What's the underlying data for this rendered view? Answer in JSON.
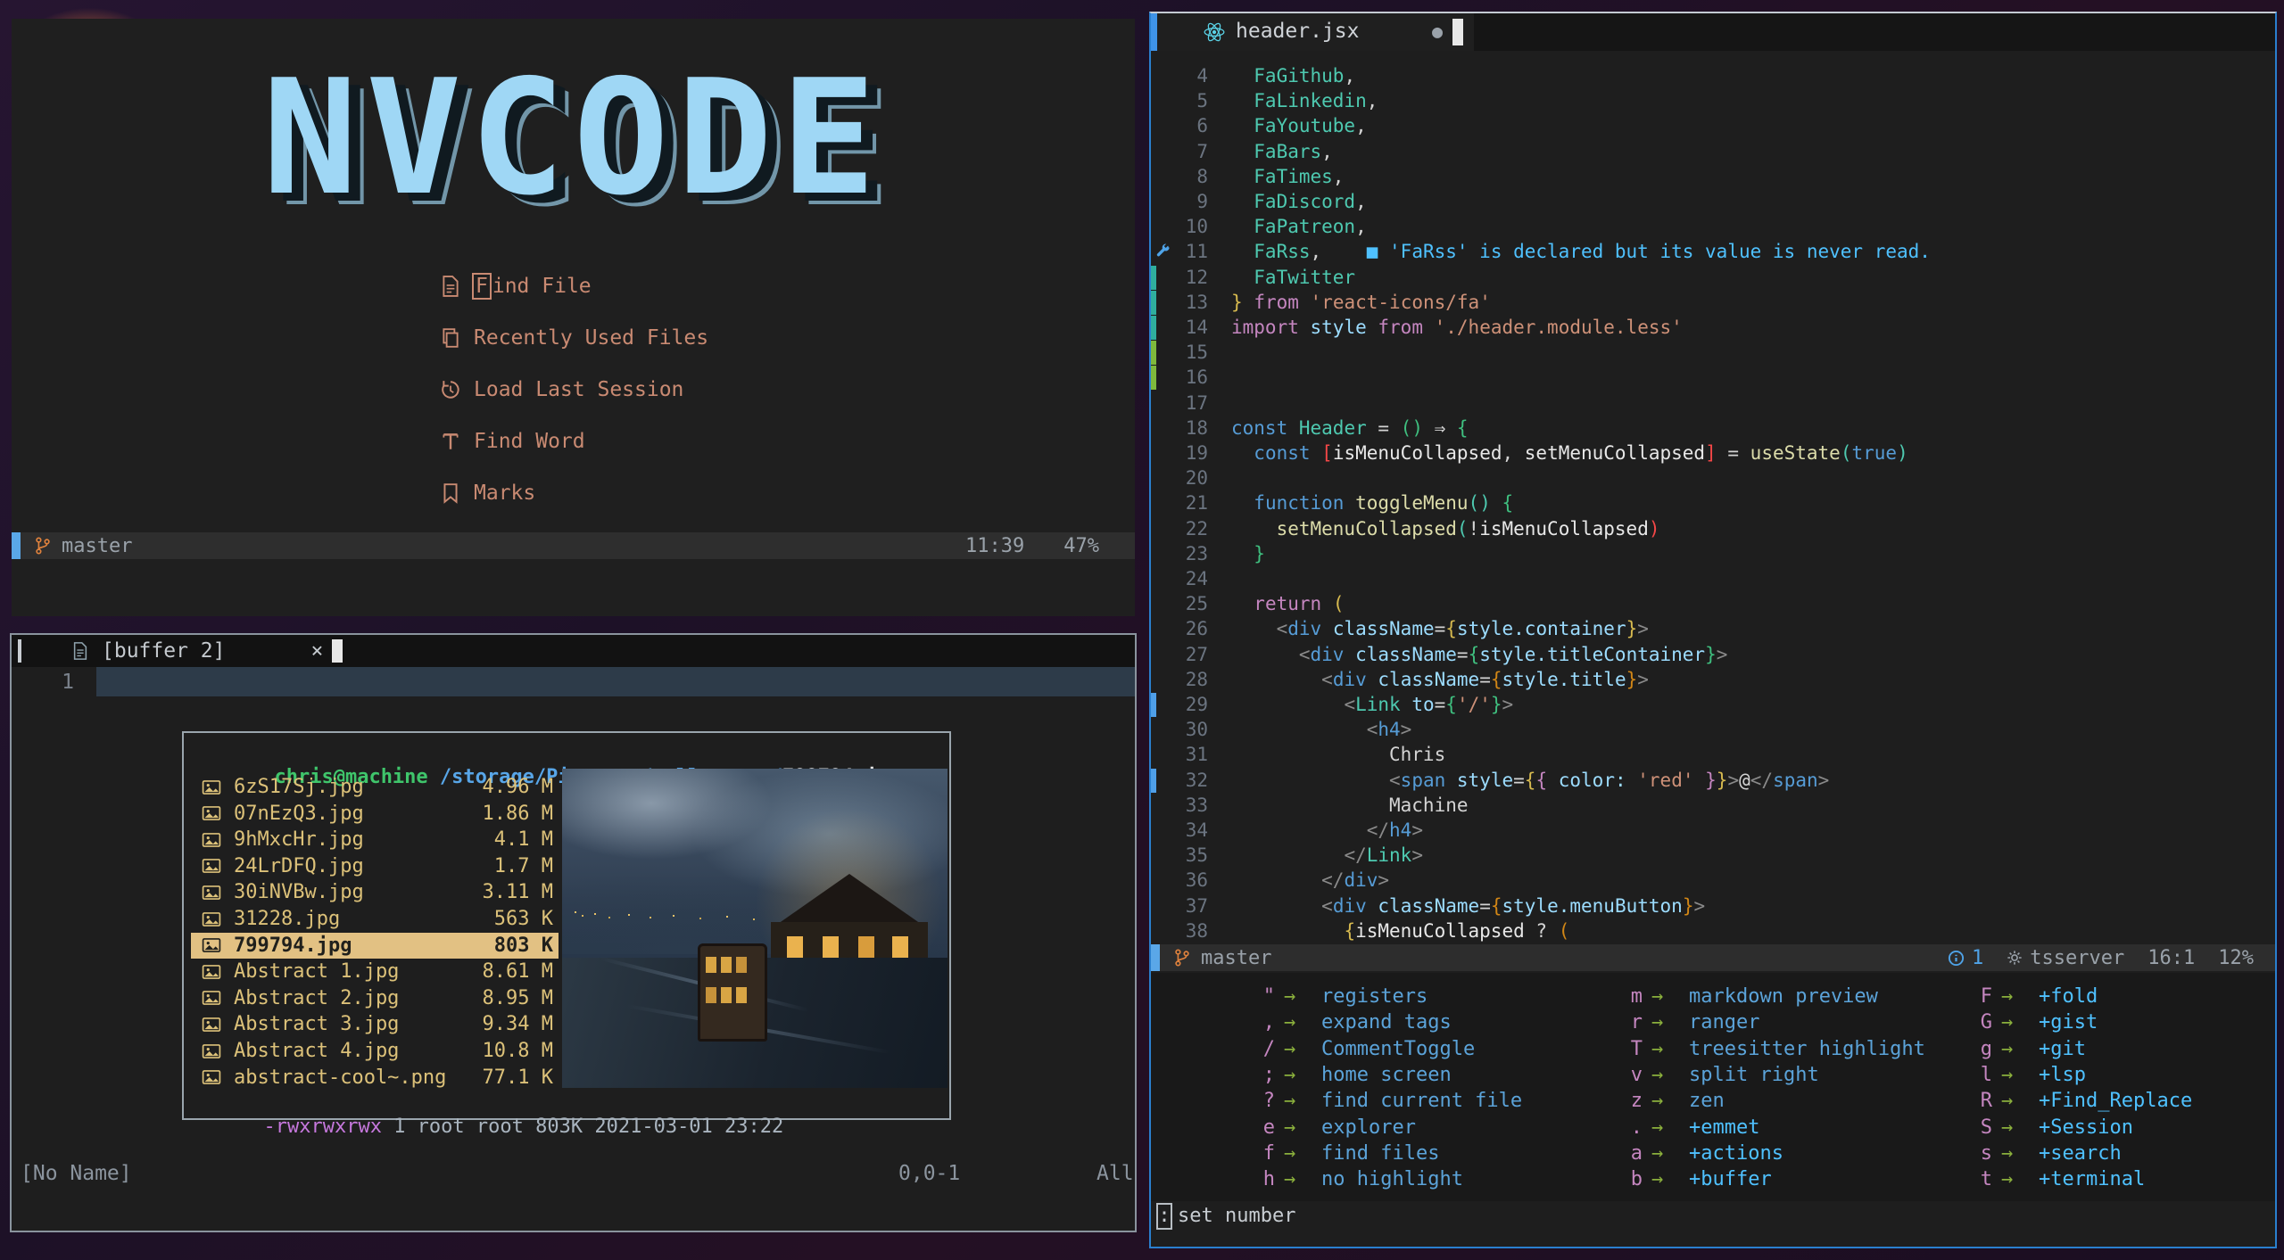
{
  "palette": {
    "fg": "#d4d4d4",
    "fgb": "#e8e8e8",
    "teal": "#4ec9b0",
    "blue": "#569cd6",
    "lightblue": "#9cdcfe",
    "magenta": "#c586c0",
    "string": "#ce9178",
    "yellow": "#d7ba4f",
    "yellowfn": "#dcdcaa",
    "green": "#3fbf7f",
    "orange": "#d18616",
    "red": "#f44747",
    "angle": "#8a8a8a",
    "diag": "#4fc1ff",
    "wkkey": "#c586c0",
    "wkarrow": "#8aaf3c",
    "wkdesc": "#5ba3d9",
    "wkgroup": "#4fc1ff",
    "dash": "#c98a72",
    "logo": "#9fd7f5",
    "fileyellow": "#dcc179",
    "usergreen": "#3fc56b",
    "pathblue": "#58a6e8",
    "selbg": "#e2c183",
    "permpurple": "#c678dd",
    "permgrey": "#a9b4bf",
    "statusfg": "#9aa2aa",
    "branch": "#e0823d",
    "signteal": "#2fae9e",
    "signgreen": "#7fb93c",
    "signblue": "#4f9fe8",
    "statusblk": "#5aa7e8"
  },
  "dashboard": {
    "logo": "NVCODE",
    "items": [
      {
        "icon": "file-icon",
        "label": "Find File",
        "cursor": true
      },
      {
        "icon": "copy-icon",
        "label": "Recently Used Files"
      },
      {
        "icon": "history-icon",
        "label": "Load Last Session"
      },
      {
        "icon": "type-icon",
        "label": "Find Word"
      },
      {
        "icon": "bookmark-icon",
        "label": "Marks"
      }
    ],
    "statusline": {
      "branch": "master",
      "time": "11:39",
      "percent": "47%"
    }
  },
  "buffer_window": {
    "tab": {
      "label": "[buffer 2]",
      "close": "×"
    },
    "line_number": "1",
    "terminal": {
      "user": "chris@machine",
      "path": " /storage/Pictures/wallpapers/",
      "file": "799794.jpg",
      "files": [
        {
          "name": "6zS17Sj.jpg",
          "size": "4.96 M"
        },
        {
          "name": "07nEzQ3.jpg",
          "size": "1.86 M"
        },
        {
          "name": "9hMxcHr.jpg",
          "size": "4.1 M"
        },
        {
          "name": "24LrDFQ.jpg",
          "size": "1.7 M"
        },
        {
          "name": "30iNVBw.jpg",
          "size": "3.11 M"
        },
        {
          "name": "31228.jpg",
          "size": "563 K"
        },
        {
          "name": "799794.jpg",
          "size": "803 K",
          "selected": true
        },
        {
          "name": "Abstract 1.jpg",
          "size": "8.61 M"
        },
        {
          "name": "Abstract 2.jpg",
          "size": "8.95 M"
        },
        {
          "name": "Abstract 3.jpg",
          "size": "9.34 M"
        },
        {
          "name": "Abstract 4.jpg",
          "size": "10.8 M"
        },
        {
          "name": "abstract-cool~.png",
          "size": "77.1 K"
        }
      ],
      "perms": "-rwxrwxrwx",
      "perms_rest": " 1 root root 803K 2021-03-01 23:22"
    },
    "statusline": {
      "name": "[No Name]",
      "position": "0,0-1",
      "scroll": "All"
    }
  },
  "editor": {
    "tab": {
      "filename": "header.jsx",
      "modified_dot": "●"
    },
    "code_lines": [
      {
        "n": 4,
        "segs": [
          {
            "t": "  FaGithub",
            "c": "teal"
          },
          {
            "t": ",",
            "c": "fg"
          }
        ]
      },
      {
        "n": 5,
        "segs": [
          {
            "t": "  FaLinkedin",
            "c": "teal"
          },
          {
            "t": ",",
            "c": "fg"
          }
        ]
      },
      {
        "n": 6,
        "segs": [
          {
            "t": "  FaYoutube",
            "c": "teal"
          },
          {
            "t": ",",
            "c": "fg"
          }
        ]
      },
      {
        "n": 7,
        "segs": [
          {
            "t": "  FaBars",
            "c": "teal"
          },
          {
            "t": ",",
            "c": "fg"
          }
        ]
      },
      {
        "n": 8,
        "segs": [
          {
            "t": "  FaTimes",
            "c": "teal"
          },
          {
            "t": ",",
            "c": "fg"
          }
        ]
      },
      {
        "n": 9,
        "segs": [
          {
            "t": "  FaDiscord",
            "c": "teal"
          },
          {
            "t": ",",
            "c": "fg"
          }
        ]
      },
      {
        "n": 10,
        "segs": [
          {
            "t": "  FaPatreon",
            "c": "teal"
          },
          {
            "t": ",",
            "c": "fg"
          }
        ]
      },
      {
        "n": 11,
        "sign": "wrench",
        "segs": [
          {
            "t": "  FaRss",
            "c": "teal"
          },
          {
            "t": ",",
            "c": "fg"
          },
          {
            "t": "    ",
            "c": "fg"
          },
          {
            "t": "■ 'FaRss' is declared but its value is never read.",
            "c": "diag"
          }
        ]
      },
      {
        "n": 12,
        "sign": "teal",
        "segs": [
          {
            "t": "  FaTwitter",
            "c": "teal"
          }
        ]
      },
      {
        "n": 13,
        "sign": "teal",
        "segs": [
          {
            "t": "}",
            "c": "yellow"
          },
          {
            "t": " ",
            "c": "fg"
          },
          {
            "t": "from",
            "c": "magenta"
          },
          {
            "t": " ",
            "c": "fg"
          },
          {
            "t": "'react-icons/fa'",
            "c": "string"
          }
        ]
      },
      {
        "n": 14,
        "sign": "teal",
        "segs": [
          {
            "t": "import",
            "c": "magenta"
          },
          {
            "t": " ",
            "c": "fg"
          },
          {
            "t": "style",
            "c": "lightblue"
          },
          {
            "t": " ",
            "c": "fg"
          },
          {
            "t": "from",
            "c": "magenta"
          },
          {
            "t": " ",
            "c": "fg"
          },
          {
            "t": "'./header.module.less'",
            "c": "string"
          }
        ]
      },
      {
        "n": 15,
        "sign": "green",
        "segs": []
      },
      {
        "n": 16,
        "sign": "green",
        "segs": []
      },
      {
        "n": 17,
        "segs": []
      },
      {
        "n": 18,
        "segs": [
          {
            "t": "const",
            "c": "blue"
          },
          {
            "t": " ",
            "c": "fg"
          },
          {
            "t": "Header",
            "c": "teal"
          },
          {
            "t": " = ",
            "c": "fg"
          },
          {
            "t": "()",
            "c": "green"
          },
          {
            "t": " ⇒ ",
            "c": "fg"
          },
          {
            "t": "{",
            "c": "green"
          }
        ]
      },
      {
        "n": 19,
        "segs": [
          {
            "t": "  ",
            "c": "fg"
          },
          {
            "t": "const",
            "c": "blue"
          },
          {
            "t": " ",
            "c": "fg"
          },
          {
            "t": "[",
            "c": "red"
          },
          {
            "t": "isMenuCollapsed",
            "c": "fgb"
          },
          {
            "t": ", ",
            "c": "fg"
          },
          {
            "t": "setMenuCollapsed",
            "c": "fgb"
          },
          {
            "t": "]",
            "c": "red"
          },
          {
            "t": " = ",
            "c": "fg"
          },
          {
            "t": "useState",
            "c": "yellowfn"
          },
          {
            "t": "(",
            "c": "teal"
          },
          {
            "t": "true",
            "c": "blue"
          },
          {
            "t": ")",
            "c": "teal"
          }
        ]
      },
      {
        "n": 20,
        "segs": []
      },
      {
        "n": 21,
        "segs": [
          {
            "t": "  ",
            "c": "fg"
          },
          {
            "t": "function",
            "c": "blue"
          },
          {
            "t": " ",
            "c": "fg"
          },
          {
            "t": "toggleMenu",
            "c": "yellowfn"
          },
          {
            "t": "()",
            "c": "teal"
          },
          {
            "t": " ",
            "c": "fg"
          },
          {
            "t": "{",
            "c": "green"
          }
        ]
      },
      {
        "n": 22,
        "segs": [
          {
            "t": "    ",
            "c": "fg"
          },
          {
            "t": "setMenuCollapsed",
            "c": "yellowfn"
          },
          {
            "t": "(",
            "c": "teal"
          },
          {
            "t": "!",
            "c": "fg"
          },
          {
            "t": "isMenuCollapsed",
            "c": "fgb"
          },
          {
            "t": ")",
            "c": "red"
          }
        ]
      },
      {
        "n": 23,
        "segs": [
          {
            "t": "  }",
            "c": "green"
          }
        ]
      },
      {
        "n": 24,
        "segs": []
      },
      {
        "n": 25,
        "segs": [
          {
            "t": "  ",
            "c": "fg"
          },
          {
            "t": "return",
            "c": "magenta"
          },
          {
            "t": " ",
            "c": "fg"
          },
          {
            "t": "(",
            "c": "yellow"
          }
        ]
      },
      {
        "n": 26,
        "segs": [
          {
            "t": "    ",
            "c": "fg"
          },
          {
            "t": "<",
            "c": "angle"
          },
          {
            "t": "div",
            "c": "blue"
          },
          {
            "t": " ",
            "c": "fg"
          },
          {
            "t": "className",
            "c": "lightblue"
          },
          {
            "t": "=",
            "c": "fg"
          },
          {
            "t": "{",
            "c": "yellow"
          },
          {
            "t": "style.container",
            "c": "lightblue"
          },
          {
            "t": "}",
            "c": "yellow"
          },
          {
            "t": ">",
            "c": "angle"
          }
        ]
      },
      {
        "n": 27,
        "segs": [
          {
            "t": "      ",
            "c": "fg"
          },
          {
            "t": "<",
            "c": "angle"
          },
          {
            "t": "div",
            "c": "blue"
          },
          {
            "t": " ",
            "c": "fg"
          },
          {
            "t": "className",
            "c": "lightblue"
          },
          {
            "t": "=",
            "c": "fg"
          },
          {
            "t": "{",
            "c": "green"
          },
          {
            "t": "style.titleContainer",
            "c": "lightblue"
          },
          {
            "t": "}",
            "c": "green"
          },
          {
            "t": ">",
            "c": "angle"
          }
        ]
      },
      {
        "n": 28,
        "segs": [
          {
            "t": "        ",
            "c": "fg"
          },
          {
            "t": "<",
            "c": "angle"
          },
          {
            "t": "div",
            "c": "blue"
          },
          {
            "t": " ",
            "c": "fg"
          },
          {
            "t": "className",
            "c": "lightblue"
          },
          {
            "t": "=",
            "c": "fg"
          },
          {
            "t": "{",
            "c": "orange"
          },
          {
            "t": "style.title",
            "c": "lightblue"
          },
          {
            "t": "}",
            "c": "orange"
          },
          {
            "t": ">",
            "c": "angle"
          }
        ]
      },
      {
        "n": 29,
        "sign": "blue",
        "segs": [
          {
            "t": "          ",
            "c": "fg"
          },
          {
            "t": "<",
            "c": "angle"
          },
          {
            "t": "Link",
            "c": "teal"
          },
          {
            "t": " ",
            "c": "fg"
          },
          {
            "t": "to",
            "c": "lightblue"
          },
          {
            "t": "=",
            "c": "fg"
          },
          {
            "t": "{",
            "c": "green"
          },
          {
            "t": "'/'",
            "c": "string"
          },
          {
            "t": "}",
            "c": "green"
          },
          {
            "t": ">",
            "c": "angle"
          }
        ]
      },
      {
        "n": 30,
        "segs": [
          {
            "t": "            ",
            "c": "fg"
          },
          {
            "t": "<",
            "c": "angle"
          },
          {
            "t": "h4",
            "c": "blue"
          },
          {
            "t": ">",
            "c": "angle"
          }
        ]
      },
      {
        "n": 31,
        "segs": [
          {
            "t": "              Chris",
            "c": "fg"
          }
        ]
      },
      {
        "n": 32,
        "sign": "blue",
        "segs": [
          {
            "t": "              ",
            "c": "fg"
          },
          {
            "t": "<",
            "c": "angle"
          },
          {
            "t": "span",
            "c": "blue"
          },
          {
            "t": " ",
            "c": "fg"
          },
          {
            "t": "style",
            "c": "lightblue"
          },
          {
            "t": "=",
            "c": "fg"
          },
          {
            "t": "{",
            "c": "yellow"
          },
          {
            "t": "{",
            "c": "magenta"
          },
          {
            "t": " ",
            "c": "fg"
          },
          {
            "t": "color:",
            "c": "lightblue"
          },
          {
            "t": " ",
            "c": "fg"
          },
          {
            "t": "'red'",
            "c": "string"
          },
          {
            "t": " ",
            "c": "fg"
          },
          {
            "t": "}",
            "c": "magenta"
          },
          {
            "t": "}",
            "c": "yellow"
          },
          {
            "t": ">",
            "c": "angle"
          },
          {
            "t": "@",
            "c": "fg"
          },
          {
            "t": "</",
            "c": "angle"
          },
          {
            "t": "span",
            "c": "blue"
          },
          {
            "t": ">",
            "c": "angle"
          }
        ]
      },
      {
        "n": 33,
        "segs": [
          {
            "t": "              Machine",
            "c": "fg"
          }
        ]
      },
      {
        "n": 34,
        "segs": [
          {
            "t": "            ",
            "c": "fg"
          },
          {
            "t": "</",
            "c": "angle"
          },
          {
            "t": "h4",
            "c": "blue"
          },
          {
            "t": ">",
            "c": "angle"
          }
        ]
      },
      {
        "n": 35,
        "segs": [
          {
            "t": "          ",
            "c": "fg"
          },
          {
            "t": "</",
            "c": "angle"
          },
          {
            "t": "Link",
            "c": "teal"
          },
          {
            "t": ">",
            "c": "angle"
          }
        ]
      },
      {
        "n": 36,
        "segs": [
          {
            "t": "        ",
            "c": "fg"
          },
          {
            "t": "</",
            "c": "angle"
          },
          {
            "t": "div",
            "c": "blue"
          },
          {
            "t": ">",
            "c": "angle"
          }
        ]
      },
      {
        "n": 37,
        "segs": [
          {
            "t": "        ",
            "c": "fg"
          },
          {
            "t": "<",
            "c": "angle"
          },
          {
            "t": "div",
            "c": "blue"
          },
          {
            "t": " ",
            "c": "fg"
          },
          {
            "t": "className",
            "c": "lightblue"
          },
          {
            "t": "=",
            "c": "fg"
          },
          {
            "t": "{",
            "c": "orange"
          },
          {
            "t": "style.menuButton",
            "c": "lightblue"
          },
          {
            "t": "}",
            "c": "orange"
          },
          {
            "t": ">",
            "c": "angle"
          }
        ]
      },
      {
        "n": 38,
        "segs": [
          {
            "t": "          ",
            "c": "fg"
          },
          {
            "t": "{",
            "c": "yellow"
          },
          {
            "t": "isMenuCollapsed",
            "c": "fgb"
          },
          {
            "t": " ? ",
            "c": "fg"
          },
          {
            "t": "(",
            "c": "orange"
          }
        ]
      }
    ],
    "statusline": {
      "branch": "master",
      "info_count": "1",
      "lsp": "tsserver",
      "position": "16:1",
      "scroll": "12%"
    },
    "whichkey": {
      "columns": [
        [
          {
            "k": "\"",
            "d": "registers"
          },
          {
            "k": ",",
            "d": "expand tags"
          },
          {
            "k": "/",
            "d": "CommentToggle"
          },
          {
            "k": ";",
            "d": "home screen"
          },
          {
            "k": "?",
            "d": "find current file"
          },
          {
            "k": "e",
            "d": "explorer"
          },
          {
            "k": "f",
            "d": "find files"
          },
          {
            "k": "h",
            "d": "no highlight"
          }
        ],
        [
          {
            "k": "m",
            "d": "markdown preview"
          },
          {
            "k": "r",
            "d": "ranger"
          },
          {
            "k": "T",
            "d": "treesitter highlight"
          },
          {
            "k": "v",
            "d": "split right"
          },
          {
            "k": "z",
            "d": "zen"
          },
          {
            "k": ".",
            "d": "+emmet"
          },
          {
            "k": "a",
            "d": "+actions"
          },
          {
            "k": "b",
            "d": "+buffer"
          }
        ],
        [
          {
            "k": "F",
            "d": "+fold"
          },
          {
            "k": "G",
            "d": "+gist"
          },
          {
            "k": "g",
            "d": "+git"
          },
          {
            "k": "l",
            "d": "+lsp"
          },
          {
            "k": "R",
            "d": "+Find_Replace"
          },
          {
            "k": "S",
            "d": "+Session"
          },
          {
            "k": "s",
            "d": "+search"
          },
          {
            "k": "t",
            "d": "+terminal"
          }
        ]
      ],
      "arrow": "→"
    },
    "cmdline": {
      "prefix": ":",
      "text": "set number"
    }
  }
}
